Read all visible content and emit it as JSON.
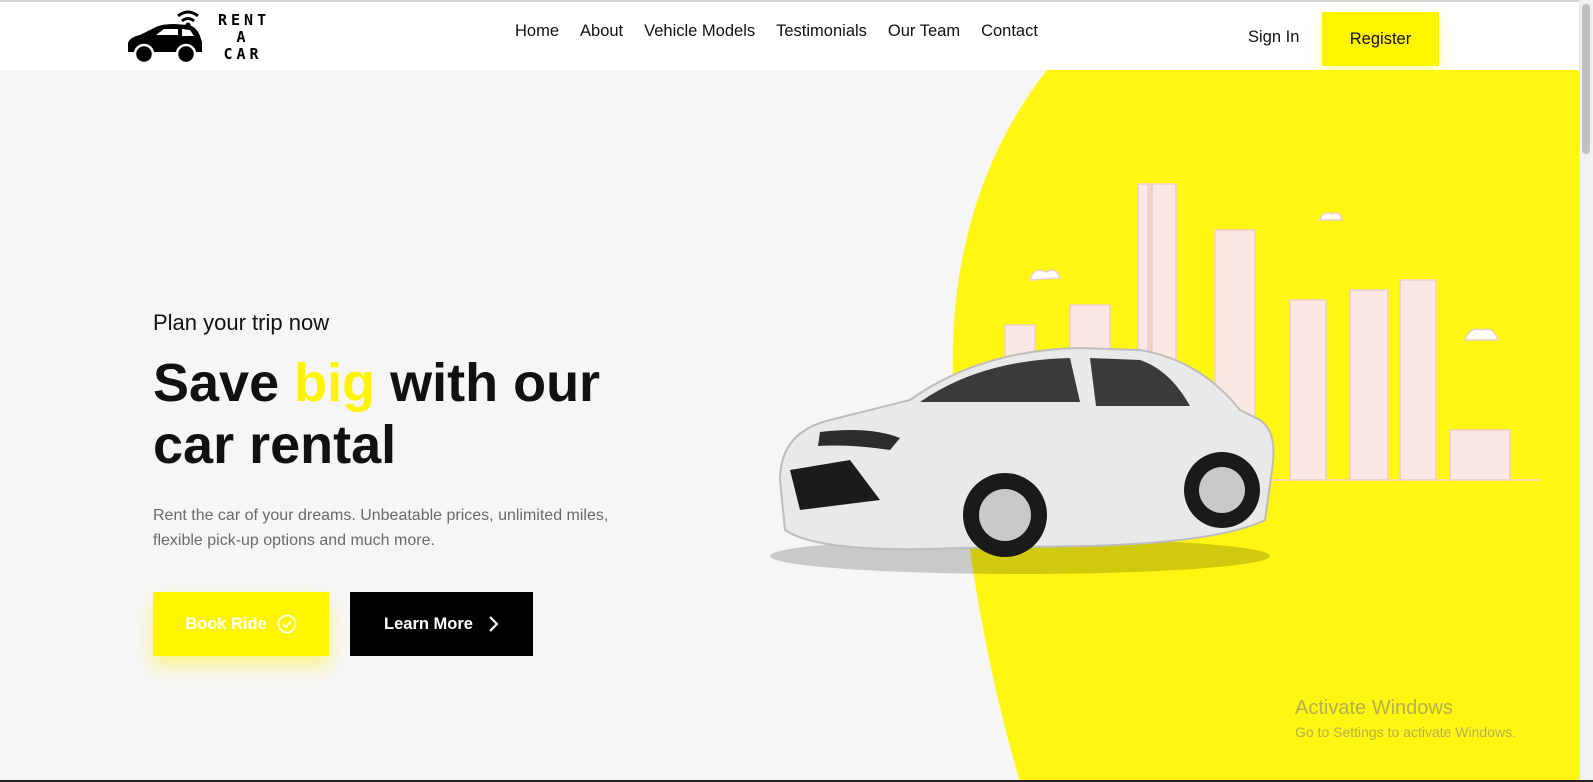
{
  "brand": {
    "logo_lines": [
      "RENT",
      "A",
      "CAR"
    ]
  },
  "nav": {
    "items": [
      {
        "label": "Home"
      },
      {
        "label": "About"
      },
      {
        "label": "Vehicle Models"
      },
      {
        "label": "Testimonials"
      },
      {
        "label": "Our Team"
      },
      {
        "label": "Contact"
      }
    ]
  },
  "auth": {
    "sign_in": "Sign In",
    "register": "Register"
  },
  "hero": {
    "eyebrow": "Plan your trip now",
    "headline_pre": "Save ",
    "headline_highlight": "big",
    "headline_post": " with our car rental",
    "lede": "Rent the car of your dreams. Unbeatable prices, unlimited miles, flexible pick-up options and much more.",
    "book_button": "Book Ride",
    "learn_button": "Learn More"
  },
  "watermark": {
    "line1": "Activate Windows",
    "line2": "Go to Settings to activate Windows."
  },
  "colors": {
    "accent": "#fff500",
    "dark": "#000000",
    "background": "#f6f6f6",
    "skyline": "#f3d9d4"
  },
  "icons": {
    "book": "check-circle-icon",
    "learn": "chevron-right-icon",
    "logo": "car-wifi-icon"
  }
}
